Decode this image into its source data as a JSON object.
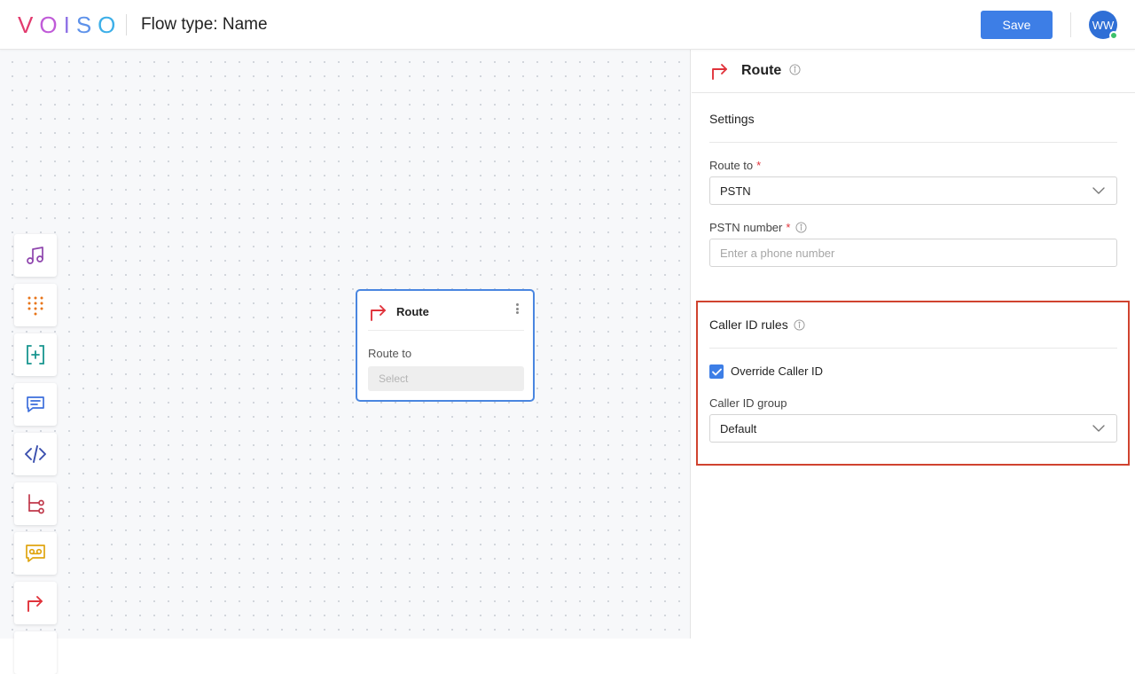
{
  "header": {
    "logo": "VOISO",
    "flow_title": "Flow type: Name",
    "save_label": "Save",
    "avatar_initials": "WW",
    "avatar_status": "online"
  },
  "toolbar": [
    {
      "icon": "music-note-icon",
      "color": "#8e44ad"
    },
    {
      "icon": "dialpad-icon",
      "color": "#e8751a"
    },
    {
      "icon": "variable-icon",
      "color": "#17958f"
    },
    {
      "icon": "message-icon",
      "color": "#3d6fdc"
    },
    {
      "icon": "code-icon",
      "color": "#3a4fae"
    },
    {
      "icon": "branch-icon",
      "color": "#c0394b"
    },
    {
      "icon": "voicemail-icon",
      "color": "#e0a510"
    },
    {
      "icon": "route-icon",
      "color": "#e0333b"
    }
  ],
  "node": {
    "title": "Route",
    "field_label": "Route to",
    "select_placeholder": "Select"
  },
  "panel": {
    "title": "Route",
    "settings_title": "Settings",
    "route_to_label": "Route to",
    "route_to_value": "PSTN",
    "pstn_label": "PSTN number",
    "pstn_placeholder": "Enter a phone number",
    "caller_id_title": "Caller ID rules",
    "override_label": "Override Caller ID",
    "override_checked": true,
    "caller_group_label": "Caller ID group",
    "caller_group_value": "Default",
    "required_mark": "*"
  },
  "colors": {
    "accent": "#3d7ee6",
    "route_red": "#e0333b",
    "highlight": "#d0432f"
  }
}
